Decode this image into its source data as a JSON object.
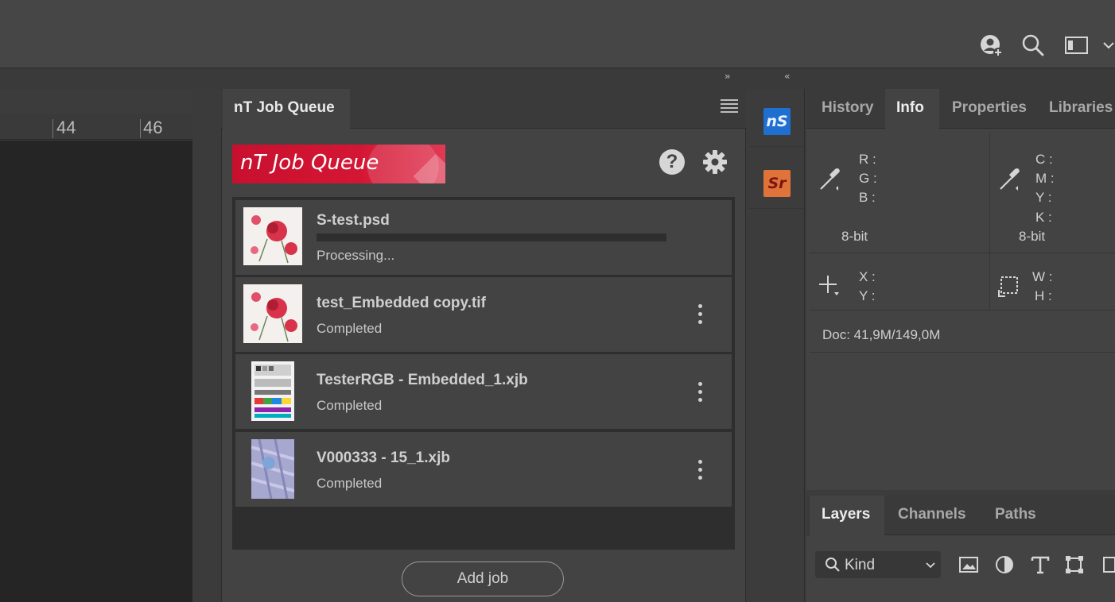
{
  "ruler": {
    "marks": [
      "44",
      "46"
    ]
  },
  "job_queue": {
    "tab_title": "nT Job Queue",
    "logo_text": "nT Job Queue",
    "help_symbol": "?",
    "jobs": [
      {
        "name": "S-test.psd",
        "status": "Processing...",
        "progress": 0
      },
      {
        "name": "test_Embedded copy.tif",
        "status": "Completed"
      },
      {
        "name": "TesterRGB - Embedded_1.xjb",
        "status": "Completed"
      },
      {
        "name": "V000333 - 15_1.xjb",
        "status": "Completed"
      }
    ],
    "add_job_label": "Add job",
    "brand_color": "#c8102e"
  },
  "strip": {
    "ns_label": "nS",
    "sr_label": "Sr"
  },
  "info_panel": {
    "tabs": [
      "History",
      "Info",
      "Properties",
      "Libraries"
    ],
    "active_tab": "Info",
    "rgb_labels": [
      "R :",
      "G :",
      "B :"
    ],
    "cmyk_labels": [
      "C :",
      "M :",
      "Y :",
      "K :"
    ],
    "bit_depth_left": "8-bit",
    "bit_depth_right": "8-bit",
    "xy_labels": [
      "X :",
      "Y :"
    ],
    "wh_labels": [
      "W :",
      "H :"
    ],
    "doc_info": "Doc: 41,9M/149,0M"
  },
  "layers_panel": {
    "tabs": [
      "Layers",
      "Channels",
      "Paths"
    ],
    "active_tab": "Layers",
    "filter_value": "Kind"
  }
}
